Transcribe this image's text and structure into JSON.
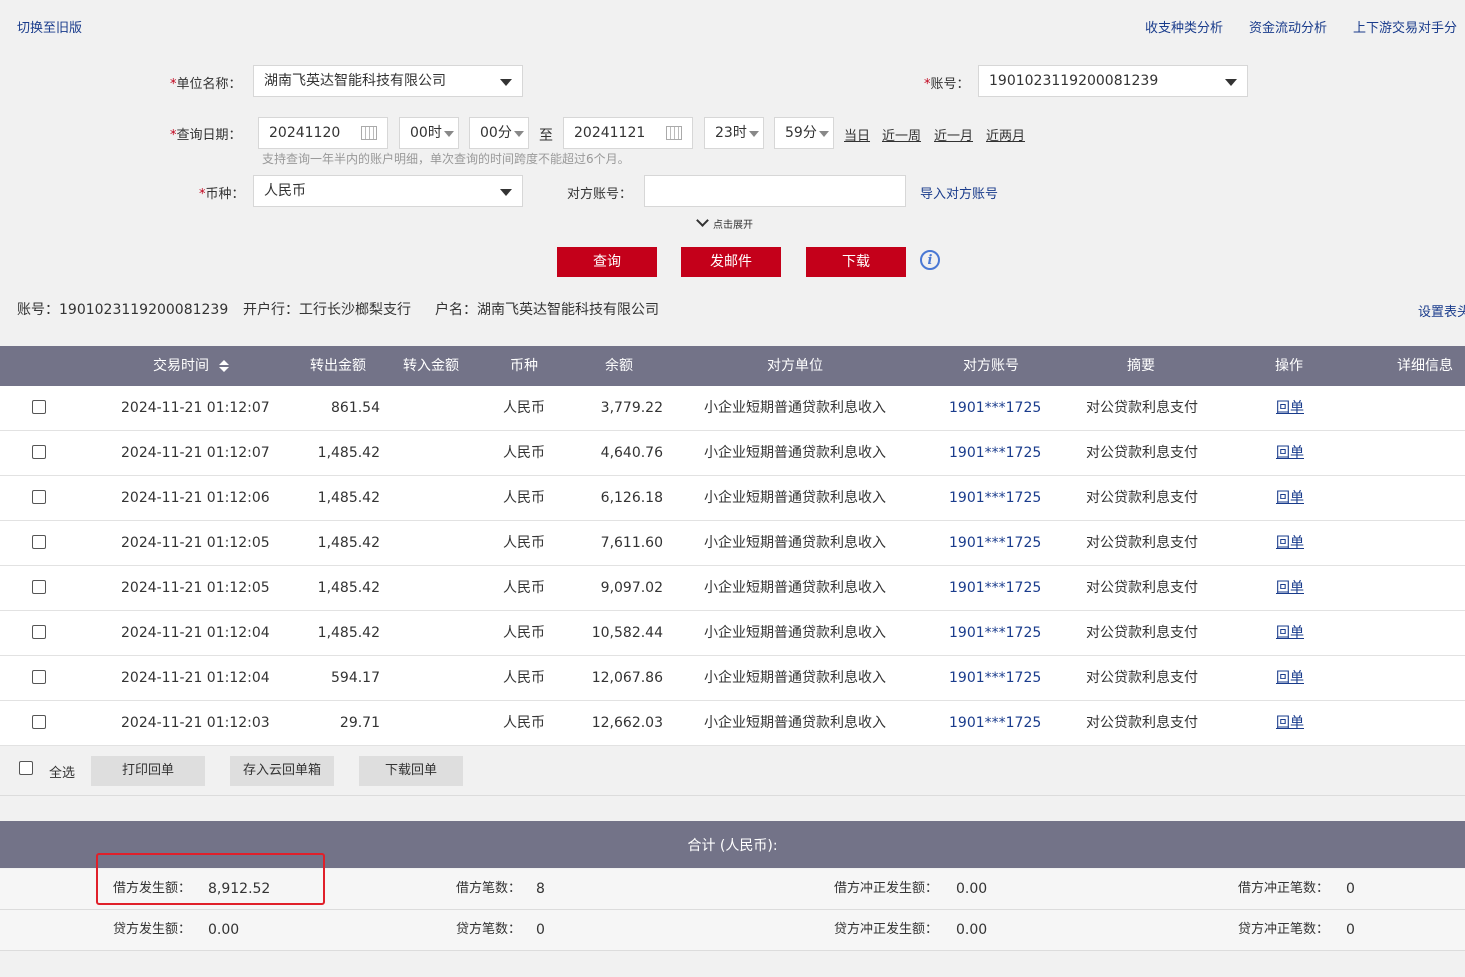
{
  "top": {
    "switch_old": "切换至旧版",
    "links": [
      "收支种类分析",
      "资金流动分析",
      "上下游交易对手分"
    ]
  },
  "form": {
    "unit_label": "单位名称：",
    "unit_value": "湖南飞英达智能科技有限公司",
    "account_label": "账号：",
    "account_value": "1901023119200081239",
    "date_label": "查询日期：",
    "start_date": "20241120",
    "start_hour": "00时",
    "start_min": "00分",
    "to": "至",
    "end_date": "20241121",
    "end_hour": "23时",
    "end_min": "59分",
    "quick_dates": [
      "当日",
      "近一周",
      "近一月",
      "近两月"
    ],
    "date_hint": "支持查询一年半内的账户明细，单次查询的时间跨度不能超过6个月。",
    "currency_label": "币种：",
    "currency_value": "人民币",
    "counter_account_label": "对方账号：",
    "counter_account_value": "",
    "import_counter": "导入对方账号",
    "expand": "点击展开",
    "btn_query": "查询",
    "btn_mail": "发邮件",
    "btn_download": "下载",
    "required_mark": "*"
  },
  "account_info": {
    "text": "账号：1901023119200081239",
    "bank": "开户行：工行长沙榔梨支行",
    "name": "户名：湖南飞英达智能科技有限公司",
    "settings": "设置表头"
  },
  "table": {
    "headers": [
      "交易时间",
      "转出金额",
      "转入金额",
      "币种",
      "余额",
      "对方单位",
      "对方账号",
      "摘要",
      "操作",
      "详细信息"
    ],
    "rows": [
      {
        "time": "2024-11-21  01:12:07",
        "out": "861.54",
        "in": "",
        "cur": "人民币",
        "bal": "3,779.22",
        "party": "小企业短期普通贷款利息收入",
        "acct": "1901***1725",
        "memo": "对公贷款利息支付",
        "op": "回单"
      },
      {
        "time": "2024-11-21  01:12:07",
        "out": "1,485.42",
        "in": "",
        "cur": "人民币",
        "bal": "4,640.76",
        "party": "小企业短期普通贷款利息收入",
        "acct": "1901***1725",
        "memo": "对公贷款利息支付",
        "op": "回单"
      },
      {
        "time": "2024-11-21  01:12:06",
        "out": "1,485.42",
        "in": "",
        "cur": "人民币",
        "bal": "6,126.18",
        "party": "小企业短期普通贷款利息收入",
        "acct": "1901***1725",
        "memo": "对公贷款利息支付",
        "op": "回单"
      },
      {
        "time": "2024-11-21  01:12:05",
        "out": "1,485.42",
        "in": "",
        "cur": "人民币",
        "bal": "7,611.60",
        "party": "小企业短期普通贷款利息收入",
        "acct": "1901***1725",
        "memo": "对公贷款利息支付",
        "op": "回单"
      },
      {
        "time": "2024-11-21  01:12:05",
        "out": "1,485.42",
        "in": "",
        "cur": "人民币",
        "bal": "9,097.02",
        "party": "小企业短期普通贷款利息收入",
        "acct": "1901***1725",
        "memo": "对公贷款利息支付",
        "op": "回单"
      },
      {
        "time": "2024-11-21  01:12:04",
        "out": "1,485.42",
        "in": "",
        "cur": "人民币",
        "bal": "10,582.44",
        "party": "小企业短期普通贷款利息收入",
        "acct": "1901***1725",
        "memo": "对公贷款利息支付",
        "op": "回单"
      },
      {
        "time": "2024-11-21  01:12:04",
        "out": "594.17",
        "in": "",
        "cur": "人民币",
        "bal": "12,067.86",
        "party": "小企业短期普通贷款利息收入",
        "acct": "1901***1725",
        "memo": "对公贷款利息支付",
        "op": "回单"
      },
      {
        "time": "2024-11-21  01:12:03",
        "out": "29.71",
        "in": "",
        "cur": "人民币",
        "bal": "12,662.03",
        "party": "小企业短期普通贷款利息收入",
        "acct": "1901***1725",
        "memo": "对公贷款利息支付",
        "op": "回单"
      }
    ],
    "select_all": "全选",
    "btn_print": "打印回单",
    "btn_cloud": "存入云回单箱",
    "btn_dl_receipt": "下载回单"
  },
  "summary": {
    "title": "合计 (人民币):",
    "debit_amount_label": "借方发生额：",
    "debit_amount": "8,912.52",
    "debit_count_label": "借方笔数：",
    "debit_count": "8",
    "debit_reversal_amount_label": "借方冲正发生额：",
    "debit_reversal_amount": "0.00",
    "debit_reversal_count_label": "借方冲正笔数：",
    "debit_reversal_count": "0",
    "credit_amount_label": "贷方发生额：",
    "credit_amount": "0.00",
    "credit_count_label": "贷方笔数：",
    "credit_count": "0",
    "credit_reversal_amount_label": "贷方冲正发生额：",
    "credit_reversal_amount": "0.00",
    "credit_reversal_count_label": "贷方冲正笔数：",
    "credit_reversal_count": "0"
  },
  "colors": {
    "header_bg": "#737388",
    "primary_red": "#c4001a",
    "link_blue": "#1a3c8c",
    "highlight_box": "#e0202a"
  }
}
